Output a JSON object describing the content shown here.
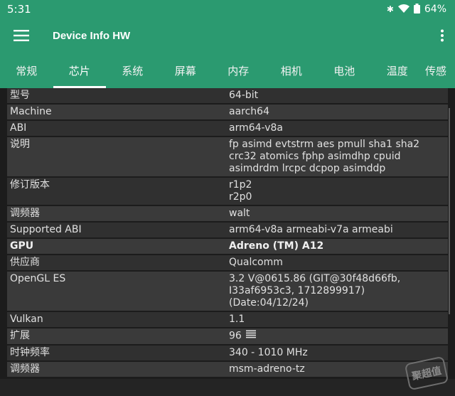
{
  "status": {
    "time": "5:31",
    "battery": "64%"
  },
  "app": {
    "title": "Device Info HW"
  },
  "tabs": [
    {
      "label": "常规"
    },
    {
      "label": "芯片",
      "active": true
    },
    {
      "label": "系统"
    },
    {
      "label": "屏幕"
    },
    {
      "label": "内存"
    },
    {
      "label": "相机"
    },
    {
      "label": "电池"
    },
    {
      "label": "温度"
    },
    {
      "label": "传感"
    }
  ],
  "rows": [
    {
      "label": "型号",
      "value": "64-bit"
    },
    {
      "label": "Machine",
      "value": "aarch64"
    },
    {
      "label": "ABI",
      "value": "arm64-v8a"
    },
    {
      "label": "说明",
      "value": "fp asimd evtstrm aes pmull sha1 sha2 crc32 atomics fphp asimdhp cpuid asimdrdm lrcpc dcpop asimddp"
    },
    {
      "label": "修订版本",
      "value": "r1p2\nr2p0"
    },
    {
      "label": "调频器",
      "value": "walt"
    },
    {
      "label": "Supported ABI",
      "value": "arm64-v8a armeabi-v7a armeabi"
    },
    {
      "label": "GPU",
      "value": "Adreno (TM) A12",
      "bold": true
    },
    {
      "label": "供应商",
      "value": "Qualcomm"
    },
    {
      "label": "OpenGL ES",
      "value": "3.2 V@0615.86 (GIT@30f48d66fb, I33af6953c3, 1712899917) (Date:04/12/24)"
    },
    {
      "label": "Vulkan",
      "value": "1.1"
    },
    {
      "label": "扩展",
      "value": "96",
      "icon": "list-icon"
    },
    {
      "label": "时钟频率",
      "value": "340 - 1010 MHz"
    },
    {
      "label": "调频器",
      "value": "msm-adreno-tz"
    }
  ],
  "watermark": "聚超值",
  "colors": {
    "accent": "#2b9a70",
    "row": "#303030",
    "row_alt": "#3a3a3a",
    "background": "#1c1c1c"
  }
}
